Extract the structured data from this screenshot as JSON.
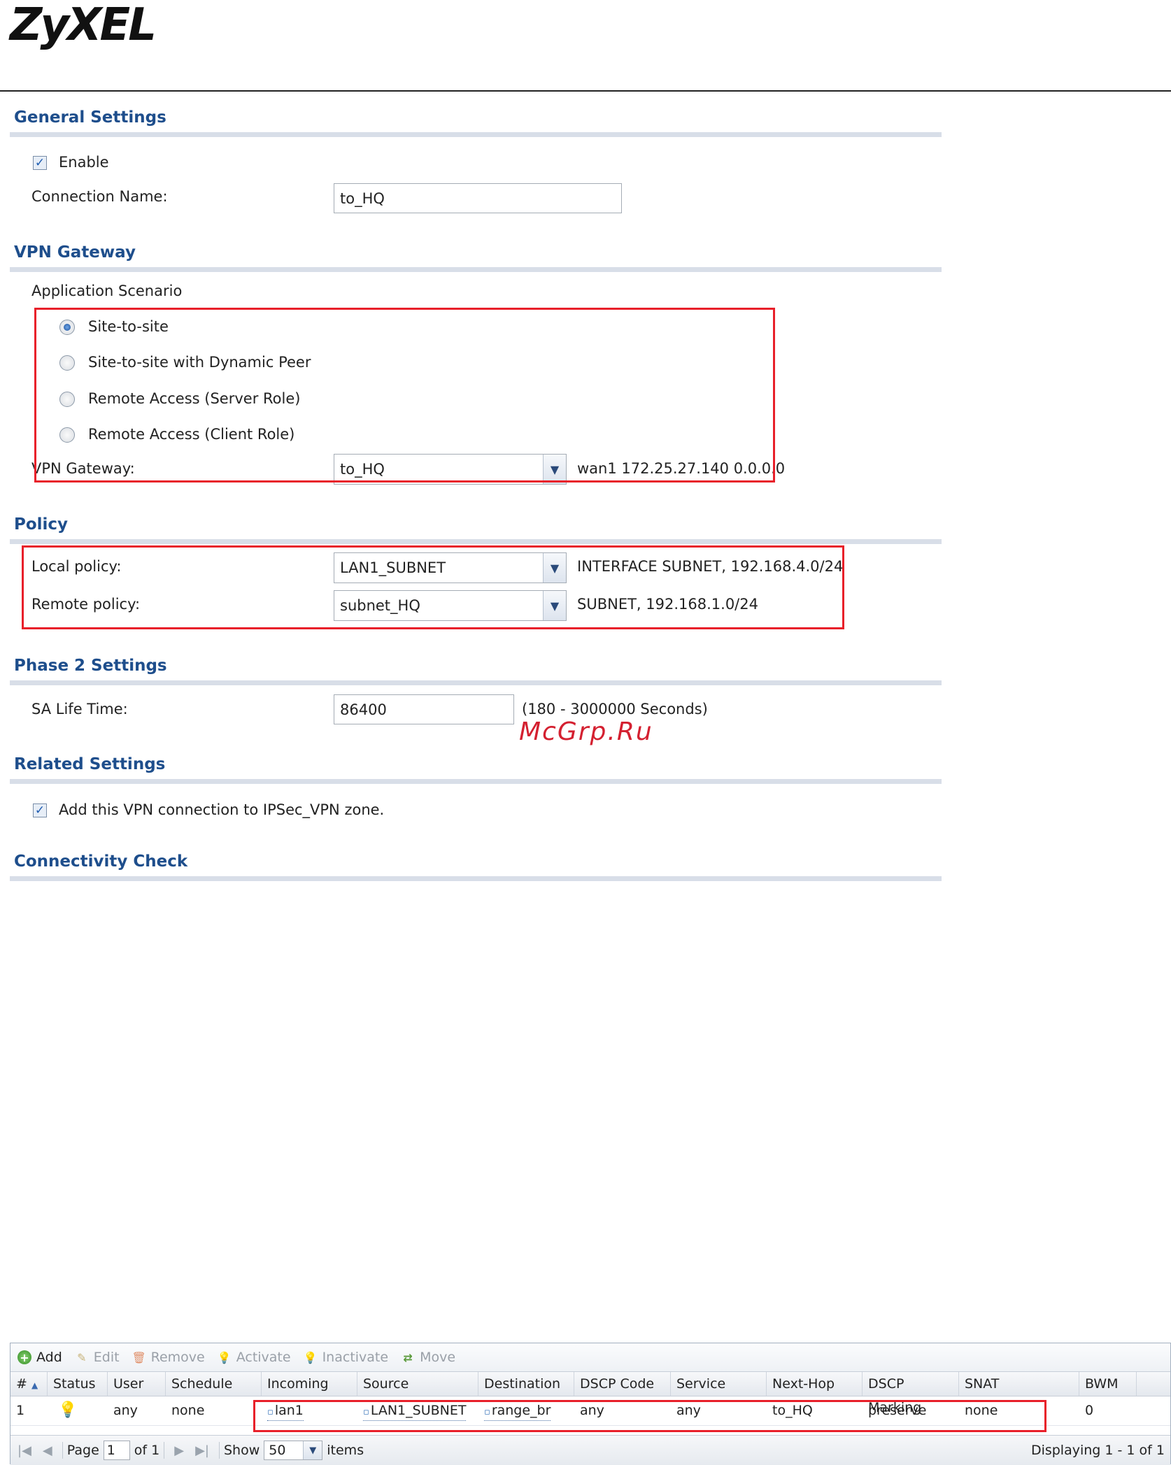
{
  "brand": {
    "logo_text": "ZyXEL"
  },
  "watermark": "McGrp.Ru",
  "general": {
    "title": "General Settings",
    "enable_label": "Enable",
    "enable_checked": true,
    "connection_name_label": "Connection Name:",
    "connection_name_value": "to_HQ"
  },
  "vpn_gateway": {
    "title": "VPN Gateway",
    "scenario_label": "Application Scenario",
    "scenarios": [
      {
        "label": "Site-to-site",
        "selected": true
      },
      {
        "label": "Site-to-site with Dynamic Peer",
        "selected": false
      },
      {
        "label": "Remote Access (Server Role)",
        "selected": false
      },
      {
        "label": "Remote Access (Client Role)",
        "selected": false
      }
    ],
    "gateway_label": "VPN Gateway:",
    "gateway_value": "to_HQ",
    "gateway_info": "wan1 172.25.27.140 0.0.0.0"
  },
  "policy": {
    "title": "Policy",
    "local_label": "Local policy:",
    "local_value": "LAN1_SUBNET",
    "local_info": "INTERFACE SUBNET, 192.168.4.0/24",
    "remote_label": "Remote policy:",
    "remote_value": "subnet_HQ",
    "remote_info": "SUBNET, 192.168.1.0/24"
  },
  "phase2": {
    "title": "Phase 2 Settings",
    "sa_label": "SA Life Time:",
    "sa_value": "86400",
    "sa_hint": "(180 - 3000000 Seconds)"
  },
  "related": {
    "title": "Related Settings",
    "zone_label": "Add this VPN connection to IPSec_VPN zone.",
    "zone_checked": true
  },
  "connectivity": {
    "title": "Connectivity Check"
  },
  "grid": {
    "toolbar": {
      "add": "Add",
      "edit": "Edit",
      "remove": "Remove",
      "activate": "Activate",
      "inactivate": "Inactivate",
      "move": "Move"
    },
    "columns": [
      "#",
      "Status",
      "User",
      "Schedule",
      "Incoming",
      "Source",
      "Destination",
      "DSCP Code",
      "Service",
      "Next-Hop",
      "DSCP Marking",
      "SNAT",
      "BWM"
    ],
    "row": {
      "num": "1",
      "user": "any",
      "schedule": "none",
      "incoming": "lan1",
      "source": "LAN1_SUBNET",
      "destination": "range_br",
      "dscp_code": "any",
      "service": "any",
      "next_hop": "to_HQ",
      "dscp_marking": "preserve",
      "snat": "none",
      "bwm": "0"
    },
    "pager": {
      "page_label": "Page",
      "page_value": "1",
      "of_label": "of 1",
      "show_label": "Show",
      "show_value": "50",
      "items_label": "items",
      "displaying": "Displaying 1 - 1 of 1"
    }
  }
}
